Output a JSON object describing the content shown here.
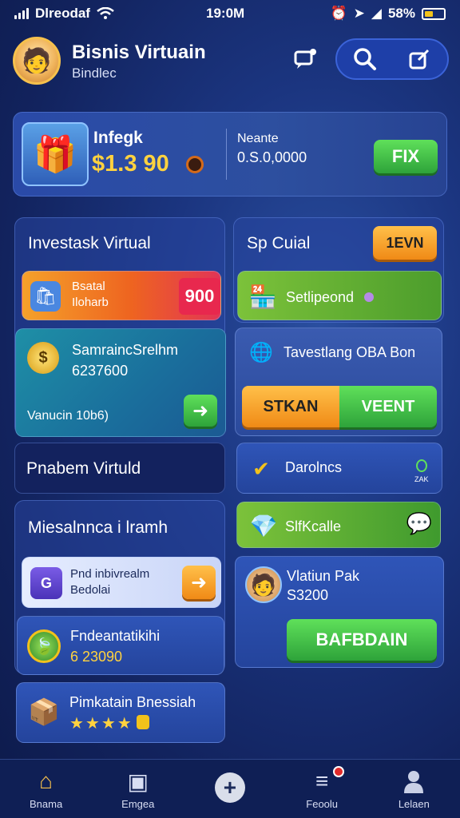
{
  "status_bar": {
    "carrier": "Dlreodaf",
    "time": "19:0M",
    "battery": "58%"
  },
  "header": {
    "title": "Bisnis Virtuain",
    "subtitle": "Bindlec"
  },
  "wallet": {
    "label": "Infegk",
    "amount": "$1.3 90",
    "right_label": "Neante",
    "right_value": "0.S.0,0000",
    "button": "FIX"
  },
  "left_column": {
    "section_title": "Investask Virtual",
    "offer_card": {
      "line1": "Bsatal",
      "line2": "Iloharb",
      "value": "900"
    },
    "teal_card": {
      "title": "SamraincSrelhm",
      "value": "6237600",
      "footer": "Vanucin 10b6)"
    },
    "banner": "Pnabem Virtuld",
    "section2_title": "Miesalnnca i lramh",
    "light_card": {
      "line1": "Pnd inbivrealm",
      "line2": "Bedolai"
    },
    "leaf_card": {
      "title": "Fndeantatikihi",
      "value": "6 23090"
    },
    "box_card": {
      "title": "Pimkatain Bnessiah",
      "stars": "★★★★"
    }
  },
  "right_column": {
    "section_title": "Sp Cuial",
    "section_badge": "1EVN",
    "green_card": {
      "label": "Setlipeond"
    },
    "invest_card": {
      "title": "Tavestlang OBA Bon",
      "btn_left": "STKAN",
      "btn_right": "VEENT"
    },
    "blue_card": {
      "label": "Darolncs",
      "badge": "ZAK"
    },
    "green_card2": {
      "label": "SlfKcalle"
    },
    "profile_card": {
      "name": "Vlatiun Pak",
      "value": "S3200",
      "button": "BAFBDAIN"
    }
  },
  "nav": [
    {
      "label": "Bnama",
      "icon": "home-icon",
      "glyph": "⌂"
    },
    {
      "label": "Emgea",
      "icon": "picture-icon",
      "glyph": "▣"
    },
    {
      "label": "",
      "icon": "plus-icon",
      "glyph": "+"
    },
    {
      "label": "Feoolu",
      "icon": "list-icon",
      "glyph": "≡"
    },
    {
      "label": "Lelaen",
      "icon": "profile-icon",
      "glyph": "●"
    }
  ],
  "colors": {
    "accent_green": "#3cbf3f",
    "accent_orange": "#f5a21e",
    "gold": "#ffd23f",
    "bg": "#1b3580"
  }
}
